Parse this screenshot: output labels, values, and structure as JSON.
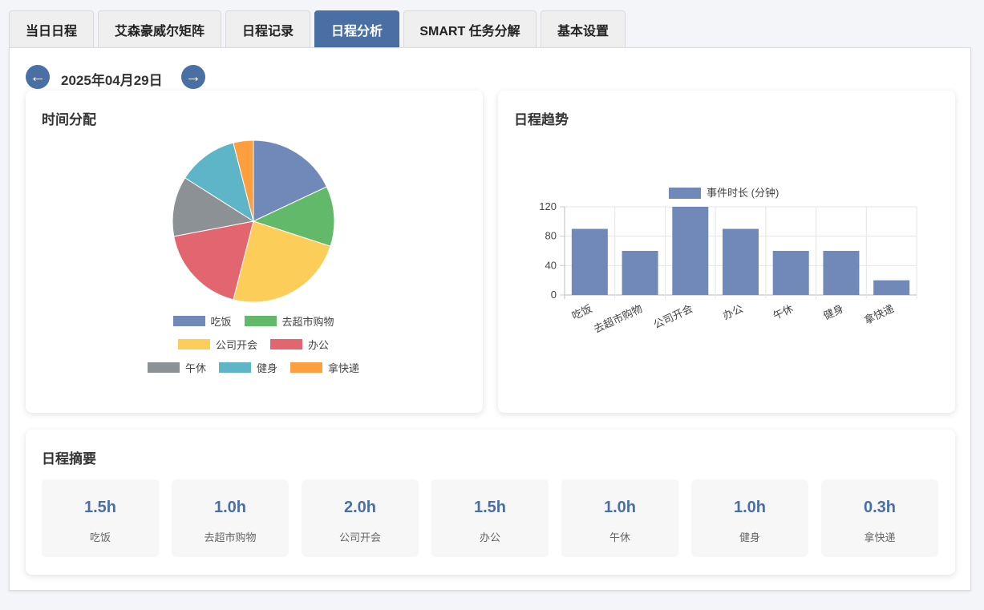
{
  "tabs": [
    {
      "label": "当日日程",
      "active": false
    },
    {
      "label": "艾森豪威尔矩阵",
      "active": false
    },
    {
      "label": "日程记录",
      "active": false
    },
    {
      "label": "日程分析",
      "active": true
    },
    {
      "label": "SMART 任务分解",
      "active": false
    },
    {
      "label": "基本设置",
      "active": false
    }
  ],
  "date_nav": {
    "prev_icon": "arrow-left-icon",
    "prev_glyph": "←",
    "next_icon": "arrow-right-icon",
    "next_glyph": "→",
    "date": "2025年04月29日"
  },
  "time_allocation": {
    "title": "时间分配"
  },
  "trend": {
    "title": "日程趋势"
  },
  "summary": {
    "title": "日程摘要",
    "items": [
      {
        "value": "1.5h",
        "label": "吃饭"
      },
      {
        "value": "1.0h",
        "label": "去超市购物"
      },
      {
        "value": "2.0h",
        "label": "公司开会"
      },
      {
        "value": "1.5h",
        "label": "办公"
      },
      {
        "value": "1.0h",
        "label": "午休"
      },
      {
        "value": "1.0h",
        "label": "健身"
      },
      {
        "value": "0.3h",
        "label": "拿快递"
      }
    ]
  },
  "colors": {
    "accent": "#4a6fa5",
    "bar": "#7189b8"
  },
  "chart_data": [
    {
      "type": "pie",
      "categories": [
        "吃饭",
        "去超市购物",
        "公司开会",
        "办公",
        "午休",
        "健身",
        "拿快递"
      ],
      "values": [
        90,
        60,
        120,
        90,
        60,
        60,
        20
      ],
      "colors": [
        "#7189b8",
        "#63b96a",
        "#fdcd5a",
        "#e2656f",
        "#8c9196",
        "#5eb5c8",
        "#fd9f3f"
      ],
      "legend": "bottom"
    },
    {
      "type": "bar",
      "categories": [
        "吃饭",
        "去超市购物",
        "公司开会",
        "办公",
        "午休",
        "健身",
        "拿快递"
      ],
      "series": [
        {
          "name": "事件时长 (分钟)",
          "values": [
            90,
            60,
            120,
            90,
            60,
            60,
            20
          ]
        }
      ],
      "yticks": [
        0,
        40,
        80,
        120
      ],
      "ylim": [
        0,
        120
      ],
      "grid": true,
      "legend": "top"
    }
  ]
}
